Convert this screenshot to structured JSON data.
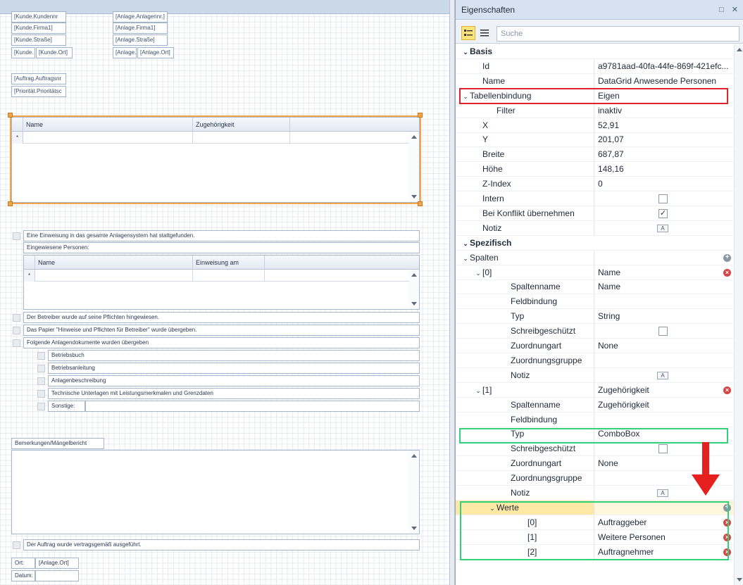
{
  "colors": {
    "red_highlight": "#e0232b",
    "green_highlight": "#31d17a",
    "selection": "#f3a34a",
    "arrow": "#e5201f"
  },
  "designer": {
    "customer_fields": [
      "[Kunde.Kundennr",
      "[Kunde.Firma1]",
      "[Kunde.Straße]",
      "[Kunde.",
      "[Kunde.Ort]"
    ],
    "plant_fields": [
      "[Anlage.Anlagennr.]",
      "[Anlage.Firma1]",
      "[Anlage.Straße]",
      "[Anlage.",
      "[Anlage.Ort]"
    ],
    "order_fields": [
      "[Auftrag.Auftragsnr",
      "[Priorität.Prioritätsc"
    ],
    "grid1": {
      "columns": [
        "Name",
        "Zugehörigkeit"
      ],
      "new_row_marker": "*"
    },
    "instruction_text": "Eine Einweisung in das gesamte Anlagensystem hat stattgefunden.",
    "instructed_label": "Eingewiesene Personen:",
    "grid2": {
      "columns": [
        "Name",
        "Einweisung am"
      ],
      "new_row_marker": "*"
    },
    "checks": [
      "Der Betreiber wurde auf seine Pflichten hingewiesen.",
      "Das Papier \"Hinweise und Pflichten für Betreiber\" wurde übergeben.",
      "Folgende Anlagendokumente wurden übergeben"
    ],
    "docs": [
      "Betriebsbuch",
      "Betriebsanleitung",
      "Anlagenbeschreibung",
      "Technische Unterlagen mit Leistungsmerkmalen und Grenzdaten",
      "Sonstige:"
    ],
    "remarks_label": "Bemerkungen/Mängelbericht",
    "final_check": "Der Auftrag wurde vertragsgemäß ausgeführt.",
    "place_label": "Ort:",
    "place_value": "[Anlage.Ort]",
    "date_label": "Datum:"
  },
  "props": {
    "title": "Eigenschaften",
    "title_buttons": [
      "□",
      "✕"
    ],
    "search_placeholder": "Suche",
    "rows": [
      {
        "type": "cat",
        "name": "Basis",
        "caret": "⌄",
        "indent": 0
      },
      {
        "name": "Id",
        "value": "a9781aad-40fa-44fe-869f-421efc...",
        "indent": 1
      },
      {
        "name": "Name",
        "value": "DataGrid Anwesende Personen",
        "indent": 1
      },
      {
        "name": "Tabellenbindung",
        "value": "Eigen",
        "caret": "⌄",
        "indent": 0
      },
      {
        "name": "Filter",
        "value": "inaktiv",
        "indent": 2
      },
      {
        "name": "X",
        "value": "52,91",
        "indent": 1
      },
      {
        "name": "Y",
        "value": "201,07",
        "indent": 1
      },
      {
        "name": "Breite",
        "value": "687,87",
        "indent": 1
      },
      {
        "name": "Höhe",
        "value": "148,16",
        "indent": 1
      },
      {
        "name": "Z-Index",
        "value": "0",
        "indent": 1
      },
      {
        "name": "Intern",
        "checkbox": false,
        "indent": 1
      },
      {
        "name": "Bei Konflikt übernehmen",
        "checkbox": true,
        "indent": 1
      },
      {
        "name": "Notiz",
        "note": true,
        "indent": 1
      },
      {
        "type": "cat",
        "name": "Spezifisch",
        "caret": "⌄",
        "indent": 0
      },
      {
        "name": "Spalten",
        "caret": "⌄",
        "add": true,
        "indent": 0
      },
      {
        "name": "[0]",
        "value": "Name",
        "caret": "⌄",
        "del": true,
        "indent": 1
      },
      {
        "name": "Spaltenname",
        "value": "Name",
        "indent": 3
      },
      {
        "name": "Feldbindung",
        "value": "",
        "indent": 3
      },
      {
        "name": "Typ",
        "value": "String",
        "indent": 3
      },
      {
        "name": "Schreibgeschützt",
        "checkbox": false,
        "indent": 3
      },
      {
        "name": "Zuordnungart",
        "value": "None",
        "indent": 3
      },
      {
        "name": "Zuordnungsgruppe",
        "value": "",
        "indent": 3
      },
      {
        "name": "Notiz",
        "note": true,
        "indent": 3
      },
      {
        "name": "[1]",
        "value": "Zugehörigkeit",
        "caret": "⌄",
        "del": true,
        "indent": 1
      },
      {
        "name": "Spaltenname",
        "value": "Zugehörigkeit",
        "indent": 3
      },
      {
        "name": "Feldbindung",
        "value": "",
        "indent": 3
      },
      {
        "name": "Typ",
        "value": "ComboBox",
        "indent": 3
      },
      {
        "name": "Schreibgeschützt",
        "checkbox": false,
        "indent": 3
      },
      {
        "name": "Zuordnungart",
        "value": "None",
        "indent": 3
      },
      {
        "name": "Zuordnungsgruppe",
        "value": "",
        "indent": 3
      },
      {
        "name": "Notiz",
        "note": true,
        "indent": 3
      },
      {
        "name": "Werte",
        "caret": "⌄",
        "add": true,
        "selected": true,
        "indent": 2
      },
      {
        "name": "[0]",
        "value": "Auftraggeber",
        "del": true,
        "indent": 4
      },
      {
        "name": "[1]",
        "value": "Weitere Personen",
        "del": true,
        "indent": 4
      },
      {
        "name": "[2]",
        "value": "Auftragnehmer",
        "del": true,
        "indent": 4
      }
    ]
  }
}
